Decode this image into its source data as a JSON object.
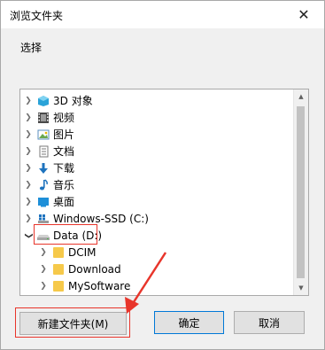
{
  "window": {
    "title": "浏览文件夹",
    "close_glyph": "✕"
  },
  "instruction": "选择",
  "tree": {
    "items": [
      {
        "label": "3D 对象",
        "icon": "3d-objects-icon"
      },
      {
        "label": "视频",
        "icon": "video-icon"
      },
      {
        "label": "图片",
        "icon": "pictures-icon"
      },
      {
        "label": "文档",
        "icon": "documents-icon"
      },
      {
        "label": "下载",
        "icon": "downloads-icon"
      },
      {
        "label": "音乐",
        "icon": "music-icon"
      },
      {
        "label": "桌面",
        "icon": "desktop-icon"
      },
      {
        "label": "Windows-SSD (C:)",
        "icon": "windows-drive-icon"
      },
      {
        "label": "Data (D:)",
        "icon": "drive-icon",
        "expanded": true,
        "highlighted": true
      },
      {
        "label": "DCIM",
        "icon": "folder-icon"
      },
      {
        "label": "Download",
        "icon": "folder-icon"
      },
      {
        "label": "MySoftware",
        "icon": "folder-icon"
      }
    ]
  },
  "buttons": {
    "new_folder": "新建文件夹(M)",
    "ok": "确定",
    "cancel": "取消"
  },
  "colors": {
    "annotation_red": "#e8352b",
    "accent_blue": "#0078d7"
  }
}
